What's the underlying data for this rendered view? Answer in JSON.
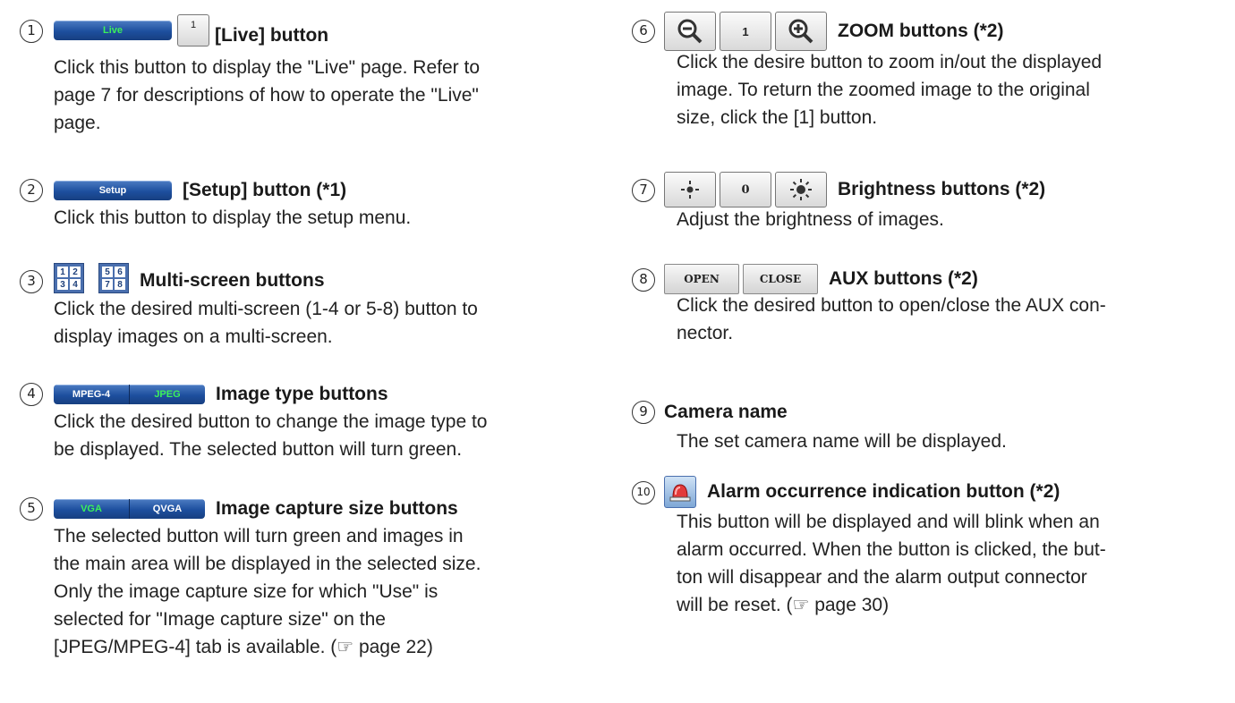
{
  "items": [
    {
      "num": "1",
      "buttons": {
        "live": "Live",
        "one": "1"
      },
      "title": "[Live] button",
      "desc": [
        "Click this button to display the \"Live\" page. Refer to",
        "page 7 for descriptions of how to operate the \"Live\"",
        "page."
      ]
    },
    {
      "num": "2",
      "buttons": {
        "setup": "Setup"
      },
      "title": "[Setup] button (*1)",
      "desc": [
        "Click this button to display the setup menu."
      ]
    },
    {
      "num": "3",
      "buttons": {
        "m1": [
          "1",
          "2",
          "3",
          "4"
        ],
        "m2": [
          "5",
          "6",
          "7",
          "8"
        ]
      },
      "title": "Multi-screen buttons",
      "desc": [
        "Click the desired multi-screen (1-4 or 5-8) button to",
        "display images on a multi-screen."
      ]
    },
    {
      "num": "4",
      "buttons": {
        "mpeg": "MPEG-4",
        "jpeg": "JPEG"
      },
      "title": "Image type buttons",
      "desc": [
        "Click the desired button to change the image type to",
        "be displayed. The selected button will turn green."
      ]
    },
    {
      "num": "5",
      "buttons": {
        "vga": "VGA",
        "qvga": "QVGA"
      },
      "title": "Image capture size buttons",
      "desc": [
        "The selected button will turn green and images in",
        "the main area will be displayed in the selected size.",
        "Only the image capture size for which \"Use\" is",
        "selected for \"Image capture size\" on the",
        "[JPEG/MPEG-4] tab is available. (☞ page 22)"
      ]
    },
    {
      "num": "6",
      "buttons": {
        "zoom_level": "1"
      },
      "title": "ZOOM buttons (*2)",
      "desc": [
        "Click the desire button to zoom in/out the displayed",
        "image. To return the zoomed image to the original",
        "size, click the [1] button."
      ]
    },
    {
      "num": "7",
      "buttons": {
        "bright_level": "0"
      },
      "title": "Brightness buttons (*2)",
      "desc": [
        "Adjust the brightness of images."
      ]
    },
    {
      "num": "8",
      "buttons": {
        "open": "OPEN",
        "close": "CLOSE"
      },
      "title": "AUX buttons (*2)",
      "desc": [
        "Click the desired button to open/close the AUX con-",
        "nector."
      ]
    },
    {
      "num": "9",
      "title": "Camera name",
      "desc": [
        "The set camera name will be displayed."
      ]
    },
    {
      "num": "10",
      "title": "Alarm occurrence indication button (*2)",
      "desc": [
        "This button will be displayed and will blink when an",
        "alarm occurred. When the button is clicked, the but-",
        "ton will disappear and the alarm output connector",
        "will be reset.  (☞ page 30)"
      ]
    }
  ],
  "colors": {
    "button_blue": "#1d4f9e",
    "selected_green": "#3cf05a"
  }
}
